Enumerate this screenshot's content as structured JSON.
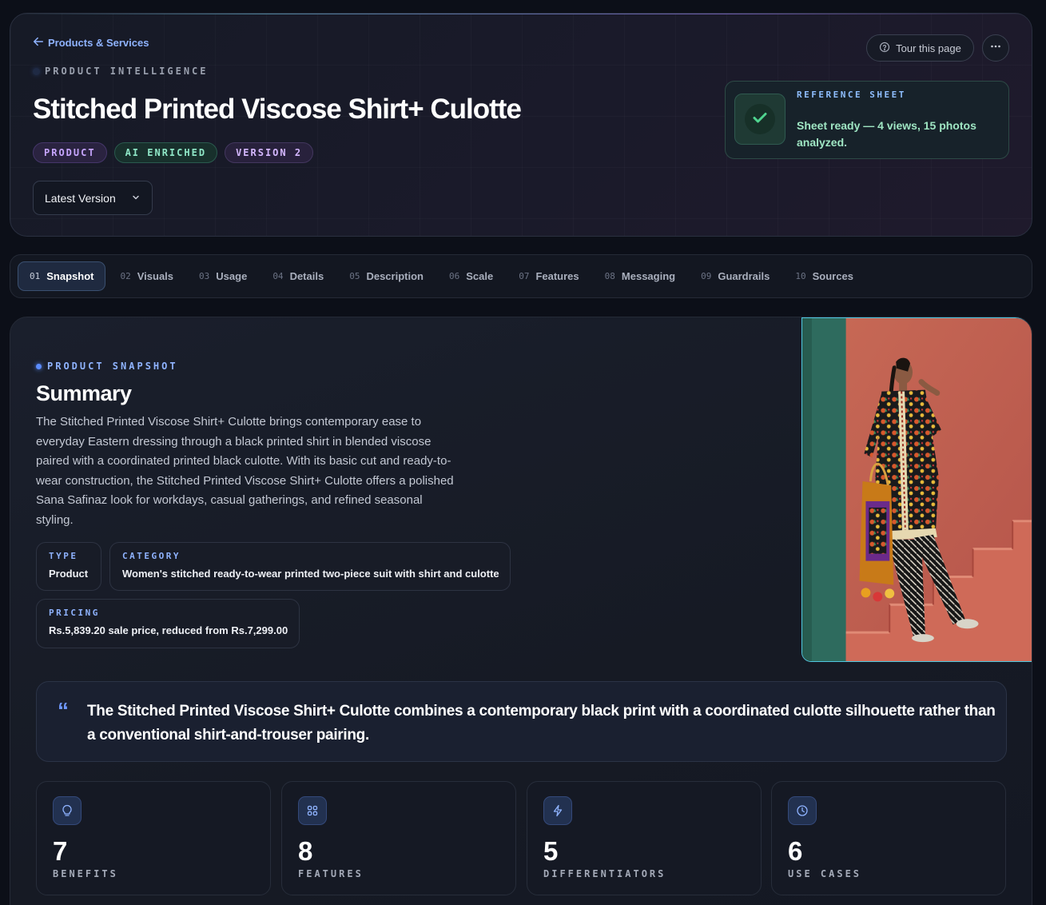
{
  "header": {
    "back_label": "Products & Services",
    "eyebrow": "PRODUCT INTELLIGENCE",
    "title": "Stitched Printed Viscose Shirt+ Culotte",
    "badges": {
      "product": "PRODUCT",
      "ai": "AI ENRICHED",
      "version": "VERSION 2"
    },
    "version_select": "Latest Version",
    "tour_label": "Tour this page"
  },
  "reference_sheet": {
    "label": "REFERENCE SHEET",
    "status": "Sheet ready — 4 views, 15 photos analyzed."
  },
  "tabs": [
    {
      "num": "01",
      "label": "Snapshot"
    },
    {
      "num": "02",
      "label": "Visuals"
    },
    {
      "num": "03",
      "label": "Usage"
    },
    {
      "num": "04",
      "label": "Details"
    },
    {
      "num": "05",
      "label": "Description"
    },
    {
      "num": "06",
      "label": "Scale"
    },
    {
      "num": "07",
      "label": "Features"
    },
    {
      "num": "08",
      "label": "Messaging"
    },
    {
      "num": "09",
      "label": "Guardrails"
    },
    {
      "num": "10",
      "label": "Sources"
    }
  ],
  "snapshot": {
    "eyebrow": "PRODUCT SNAPSHOT",
    "title": "Summary",
    "summary": "The Stitched Printed Viscose Shirt+ Culotte brings contemporary ease to everyday Eastern dressing through a black printed shirt in blended viscose paired with a coordinated printed black culotte. With its basic cut and ready-to-wear construction, the Stitched Printed Viscose Shirt+ Culotte offers a polished Sana Safinaz look for workdays, casual gatherings, and refined seasonal styling.",
    "type": {
      "label": "TYPE",
      "value": "Product"
    },
    "category": {
      "label": "CATEGORY",
      "value": "Women's stitched ready-to-wear printed two-piece suit with shirt and culotte"
    },
    "pricing": {
      "label": "PRICING",
      "value": "Rs.5,839.20 sale price, reduced from Rs.7,299.00"
    },
    "quote_mark": "“",
    "quote": "The Stitched Printed Viscose Shirt+ Culotte combines a contemporary black print with a coordinated culotte silhouette rather than a conventional shirt-and-trouser pairing."
  },
  "stats": [
    {
      "value": "7",
      "label": "BENEFITS",
      "icon": "lightbulb-icon"
    },
    {
      "value": "8",
      "label": "FEATURES",
      "icon": "grid-icon"
    },
    {
      "value": "5",
      "label": "DIFFERENTIATORS",
      "icon": "bolt-icon"
    },
    {
      "value": "6",
      "label": "USE CASES",
      "icon": "clock-icon"
    }
  ],
  "colors": {
    "accent_blue": "#8fb3ff",
    "ai_green": "#8fe7c7",
    "product_purple": "#c7a6ff",
    "ready_green": "#9fe6c3"
  }
}
